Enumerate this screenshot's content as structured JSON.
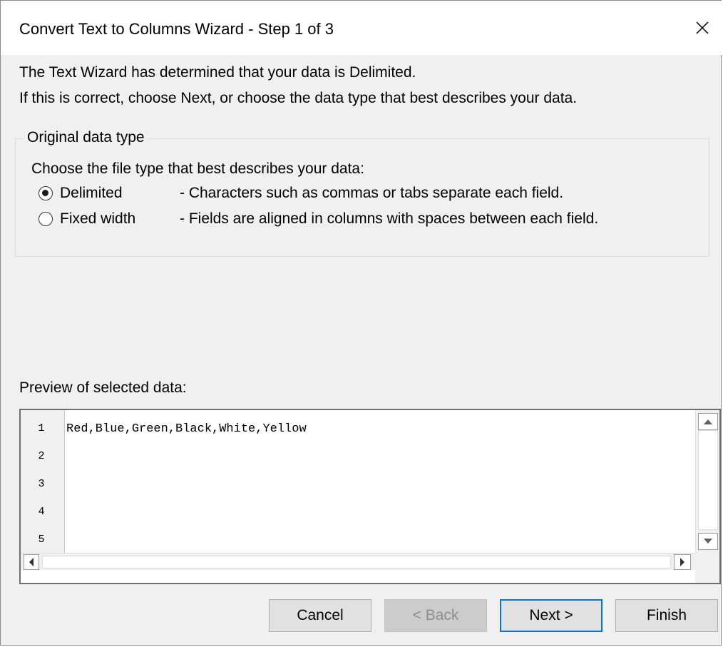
{
  "window": {
    "title": "Convert Text to Columns Wizard - Step 1 of 3"
  },
  "intro": {
    "line1": "The Text Wizard has determined that your data is Delimited.",
    "line2": "If this is correct, choose Next, or choose the data type that best describes your data."
  },
  "original_data_type": {
    "legend": "Original data type",
    "instruction": "Choose the file type that best describes your data:",
    "options": [
      {
        "label": "Delimited",
        "description": "- Characters such as commas or tabs separate each field.",
        "selected": true
      },
      {
        "label": "Fixed width",
        "description": "- Fields are aligned in columns with spaces between each field.",
        "selected": false
      }
    ]
  },
  "preview": {
    "label": "Preview of selected data:",
    "line_numbers": [
      "1",
      "2",
      "3",
      "4",
      "5"
    ],
    "lines": [
      "Red,Blue,Green,Black,White,Yellow",
      "",
      "",
      "",
      ""
    ]
  },
  "buttons": {
    "cancel": "Cancel",
    "back": "< Back",
    "next": "Next >",
    "finish": "Finish"
  },
  "colors": {
    "dialog_background": "#f0f0f0",
    "default_button_border": "#0078d7",
    "disabled_text": "#8c8c8c"
  },
  "icons": {
    "close": "close-icon",
    "scroll_up": "triangle-up-icon",
    "scroll_down": "triangle-down-icon",
    "scroll_left": "triangle-left-icon",
    "scroll_right": "triangle-right-icon"
  }
}
